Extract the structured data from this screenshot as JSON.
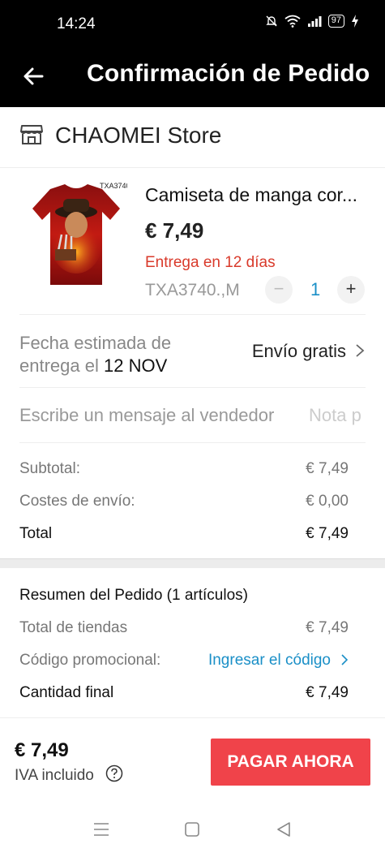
{
  "status": {
    "time": "14:24",
    "battery": "97"
  },
  "header": {
    "title": "Confirmación de Pedido"
  },
  "store": {
    "name": "CHAOMEI Store"
  },
  "product": {
    "image_label": "TXA3740",
    "title": "Camiseta de manga cor...",
    "price": "€ 7,49",
    "delivery": "Entrega en 12 días",
    "variant": "TXA3740.,M",
    "qty_minus": "−",
    "quantity": "1",
    "qty_plus": "+"
  },
  "delivery": {
    "label": "Fecha estimada de entrega el",
    "date": "12 NOV",
    "shipping": "Envío gratis"
  },
  "message": {
    "placeholder": "Escribe un mensaje al vendedor",
    "note": "Nota p"
  },
  "costs": {
    "subtotal_label": "Subtotal:",
    "subtotal_value": "€ 7,49",
    "shipping_label": "Costes de envío:",
    "shipping_value": "€ 0,00",
    "total_label": "Total",
    "total_value": "€ 7,49"
  },
  "summary": {
    "title": "Resumen del Pedido (1 artículos)",
    "stores_label": "Total de tiendas",
    "stores_value": "€ 7,49",
    "promo_label": "Código promocional:",
    "promo_link": "Ingresar el código",
    "final_label": "Cantidad final",
    "final_value": "€ 7,49"
  },
  "footer": {
    "price": "€ 7,49",
    "tax_note": "IVA incluido",
    "pay_button": "PAGAR AHORA"
  },
  "colors": {
    "accent_red": "#f0434a",
    "link_blue": "#1a8fc7",
    "delivery_red": "#d93a2b"
  },
  "icons": {
    "back": "arrow-left-icon",
    "store": "store-icon",
    "chevron": "chevron-right-icon",
    "help": "question-circle-icon",
    "nav_menu": "menu-icon",
    "nav_home": "square-icon",
    "nav_back": "triangle-back-icon"
  }
}
